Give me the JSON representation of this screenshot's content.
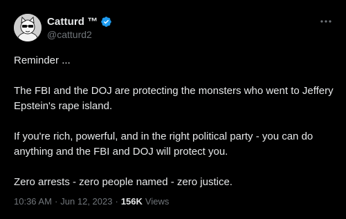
{
  "author": {
    "display_name": "Catturd ™",
    "handle": "@catturd2",
    "verified_color": "#1d9bf0",
    "avatar_icon": "cat-avatar-icon"
  },
  "tweet": {
    "paragraphs": [
      "Reminder ...",
      "The FBI and the DOJ are protecting the monsters who went to Jeffery Epstein's rape island.",
      "If you're rich, powerful, and in the right political party - you can do anything and the FBI and DOJ will protect you.",
      "Zero arrests - zero people named - zero justice."
    ]
  },
  "meta": {
    "time": "10:36 AM",
    "separator": "·",
    "date": "Jun 12, 2023",
    "separator2": "·",
    "views_count": "156K",
    "views_label": "Views"
  },
  "colors": {
    "background": "#000000",
    "text_primary": "#e7e9ea",
    "text_secondary": "#71767b",
    "accent": "#1d9bf0"
  }
}
